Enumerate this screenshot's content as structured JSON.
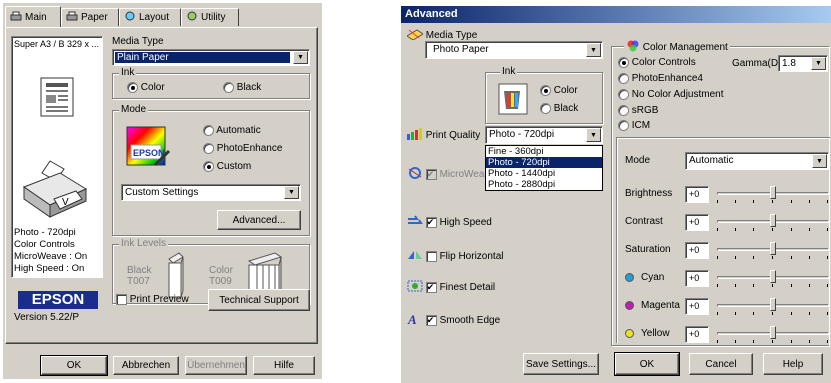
{
  "left": {
    "tabs": [
      {
        "label": "Main"
      },
      {
        "label": "Paper"
      },
      {
        "label": "Layout"
      },
      {
        "label": "Utility"
      }
    ],
    "paper_size": "Super A3 / B 329 x ...",
    "media_type_label": "Media Type",
    "media_type_value": "Plain Paper",
    "ink_group": "Ink",
    "ink_color": "Color",
    "ink_black": "Black",
    "mode_group": "Mode",
    "mode_automatic": "Automatic",
    "mode_photoenhance": "PhotoEnhance",
    "mode_custom": "Custom",
    "epson_logo_small": "EPSON",
    "custom_settings": "Custom Settings",
    "advanced_button": "Advanced...",
    "ink_levels_group": "Ink Levels",
    "ink_black_name": "Black",
    "ink_black_code": "T007",
    "ink_color_name": "Color",
    "ink_color_code": "T009",
    "summary": [
      "Photo - 720dpi",
      "Color Controls",
      "MicroWeave : On",
      "High Speed : On"
    ],
    "epson_logo": "EPSON",
    "version": "Version 5.22/P",
    "print_preview": "Print Preview",
    "technical_support": "Technical Support",
    "ok": "OK",
    "cancel": "Abbrechen",
    "apply": "Übernehmen",
    "help": "Hilfe"
  },
  "right": {
    "title": "Advanced",
    "media_type_label": "Media Type",
    "media_type_value": "Photo Paper",
    "ink_group": "Ink",
    "ink_color": "Color",
    "ink_black": "Black",
    "print_quality_label": "Print Quality",
    "print_quality_value": "Photo - 720dpi",
    "print_quality_options": [
      "Fine - 360dpi",
      "Photo - 720dpi",
      "Photo - 1440dpi",
      "Photo - 2880dpi"
    ],
    "microweave": "MicroWea",
    "high_speed": "High Speed",
    "flip_horizontal": "Flip Horizontal",
    "finest_detail": "Finest Detail",
    "smooth_edge": "Smooth Edge",
    "color_mgmt_group": "Color Management",
    "cm_color_controls": "Color Controls",
    "cm_photoenhance4": "PhotoEnhance4",
    "cm_no_adjust": "No Color Adjustment",
    "cm_srgb": "sRGB",
    "cm_icm": "ICM",
    "gamma_label": "Gamma(D)",
    "gamma_value": "1.8",
    "mode_label": "Mode",
    "mode_value": "Automatic",
    "brightness": "Brightness",
    "contrast": "Contrast",
    "saturation": "Saturation",
    "cyan": "Cyan",
    "magenta": "Magenta",
    "yellow": "Yellow",
    "slider_value": "+0",
    "save_settings": "Save Settings...",
    "ok": "OK",
    "cancel": "Cancel",
    "help": "Help"
  },
  "colors": {
    "titlebar_blue": "#0a246a",
    "select_blue": "#0a246a",
    "dialog_grey": "#d4d0c8",
    "cyan_dot": "#1e9fd8",
    "magenta_dot": "#c01cb8",
    "yellow_dot": "#f0e020"
  }
}
